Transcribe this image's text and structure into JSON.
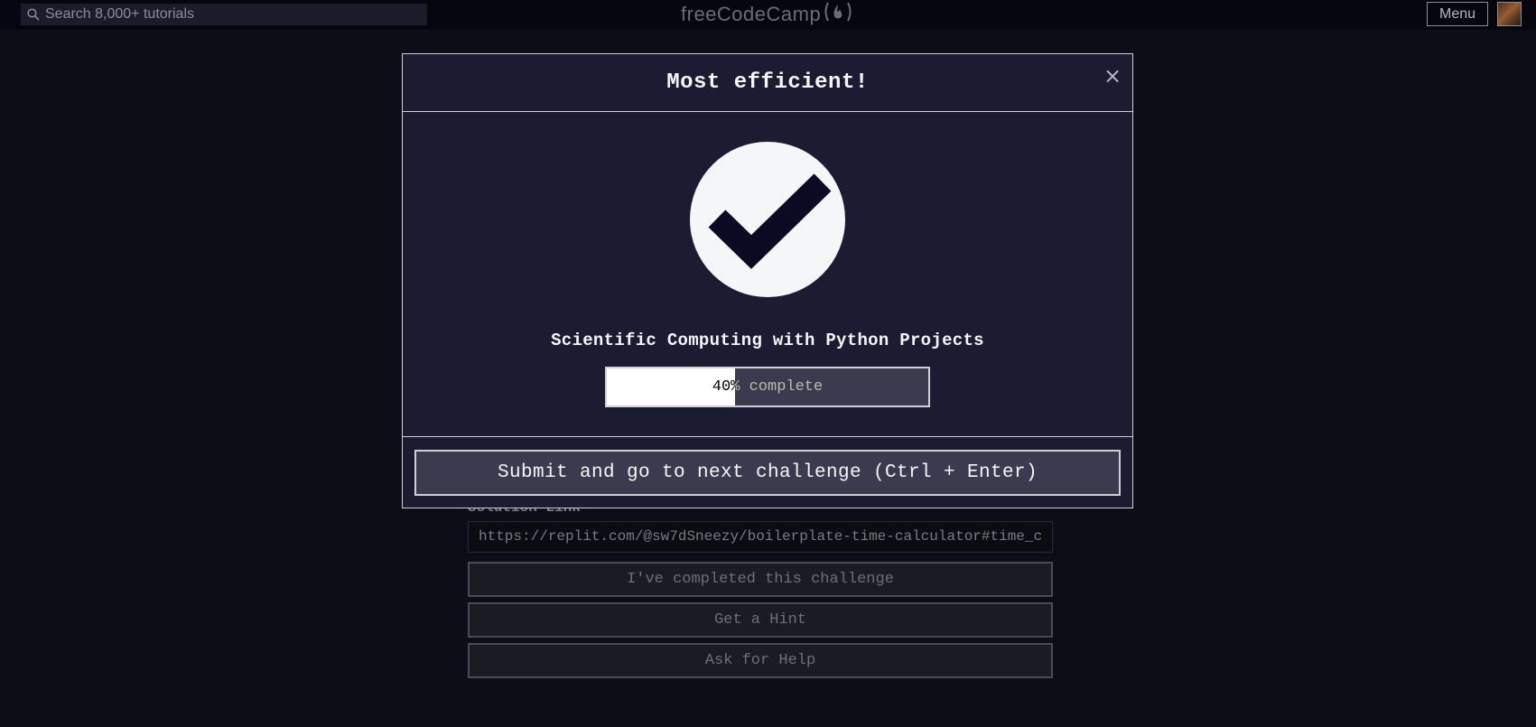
{
  "navbar": {
    "search_placeholder": "Search 8,000+ tutorials",
    "logo_text": "freeCodeCamp",
    "logo_flame": "(🔥)",
    "menu_label": "Menu"
  },
  "background": {
    "solution_label": "Solution Link",
    "solution_value": "https://replit.com/@sw7dSneezy/boilerplate-time-calculator#time_c",
    "buttons": [
      "I've completed this challenge",
      "Get a Hint",
      "Ask for Help"
    ]
  },
  "modal": {
    "title": "Most efficient!",
    "close_label": "×",
    "certification_title": "Scientific Computing with Python Projects",
    "progress_percent": 40,
    "progress_text": "40% complete",
    "submit_label": "Submit and go to next challenge (Ctrl + Enter)"
  },
  "colors": {
    "background": "#0d0d17",
    "modal_background": "#1b1b32",
    "button_background": "#3b3b4f",
    "foreground": "#f5f6f7",
    "check_color": "#0a0a23"
  }
}
